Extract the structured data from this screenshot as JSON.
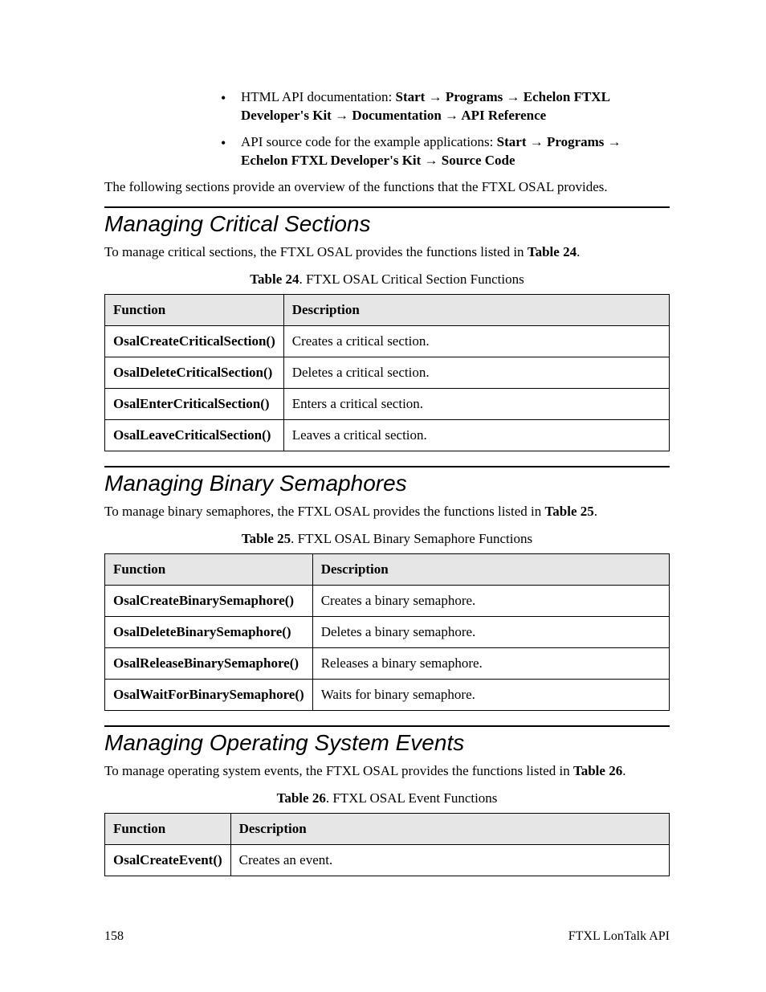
{
  "bullets": [
    {
      "lead": "HTML API documentation:  ",
      "path": "Start → Programs → Echelon FTXL Developer's Kit → Documentation → API Reference"
    },
    {
      "lead": "API source code for the example applications:  ",
      "path": "Start → Programs → Echelon FTXL Developer's Kit → Source Code"
    }
  ],
  "overview_para": "The following sections provide an overview of the functions that the FTXL OSAL provides.",
  "sections": [
    {
      "heading": "Managing Critical Sections",
      "intro_pre": "To manage critical sections, the FTXL OSAL provides the functions listed in ",
      "intro_ref": "Table 24",
      "intro_post": ".",
      "caption_label": "Table 24",
      "caption_rest": ". FTXL OSAL Critical Section Functions",
      "col1": "Function",
      "col2": "Description",
      "rows": [
        {
          "fn": "OsalCreateCriticalSection()",
          "desc": "Creates a critical section."
        },
        {
          "fn": "OsalDeleteCriticalSection()",
          "desc": "Deletes a critical section."
        },
        {
          "fn": "OsalEnterCriticalSection()",
          "desc": "Enters a critical section."
        },
        {
          "fn": "OsalLeaveCriticalSection()",
          "desc": "Leaves a critical section."
        }
      ]
    },
    {
      "heading": "Managing Binary Semaphores",
      "intro_pre": "To manage binary semaphores, the FTXL OSAL provides the functions listed in ",
      "intro_ref": "Table 25",
      "intro_post": ".",
      "caption_label": "Table 25",
      "caption_rest": ". FTXL OSAL Binary Semaphore Functions",
      "col1": "Function",
      "col2": "Description",
      "rows": [
        {
          "fn": "OsalCreateBinarySemaphore()",
          "desc": "Creates a binary semaphore."
        },
        {
          "fn": "OsalDeleteBinarySemaphore()",
          "desc": "Deletes a binary semaphore."
        },
        {
          "fn": "OsalReleaseBinarySemaphore()",
          "desc": "Releases a binary semaphore."
        },
        {
          "fn": "OsalWaitForBinarySemaphore()",
          "desc": "Waits for binary semaphore."
        }
      ]
    },
    {
      "heading": "Managing Operating System Events",
      "intro_pre": "To manage operating system events, the FTXL OSAL provides the functions listed in ",
      "intro_ref": "Table 26",
      "intro_post": ".",
      "caption_label": "Table 26",
      "caption_rest": ". FTXL OSAL Event Functions",
      "col1": "Function",
      "col2": "Description",
      "rows": [
        {
          "fn": "OsalCreateEvent()",
          "desc": "Creates an event."
        }
      ]
    }
  ],
  "footer": {
    "page": "158",
    "title": "FTXL LonTalk API"
  }
}
